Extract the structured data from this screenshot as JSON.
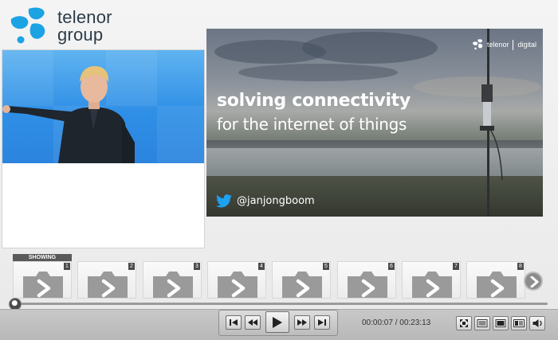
{
  "brand": {
    "logo_line1": "telenor",
    "logo_line2": "group",
    "logo_icon": "telenor-propeller-logo",
    "color": "#1ca3e3"
  },
  "slide": {
    "title_line1": "solving connectivity",
    "title_line2": "for the internet of things",
    "brand_name": "telenor",
    "brand_suffix": "digital",
    "twitter_handle": "@janjongboom",
    "twitter_icon": "twitter-bird-icon"
  },
  "thumbnails": {
    "showing_label": "SHOWING",
    "items": [
      {
        "num": "1",
        "icon": "play-placeholder-icon"
      },
      {
        "num": "2",
        "icon": "play-placeholder-icon"
      },
      {
        "num": "3",
        "icon": "play-placeholder-icon"
      },
      {
        "num": "4",
        "icon": "play-placeholder-icon"
      },
      {
        "num": "5",
        "icon": "play-placeholder-icon"
      },
      {
        "num": "6",
        "icon": "play-placeholder-icon"
      },
      {
        "num": "7",
        "icon": "play-placeholder-icon"
      },
      {
        "num": "8",
        "icon": "play-placeholder-icon"
      }
    ],
    "next_icon": "chevron-right-icon"
  },
  "playback": {
    "current_time": "00:00:07",
    "total_time": "00:23:13",
    "separator": " / ",
    "progress_fraction": 0.005
  },
  "controls": {
    "transport": [
      "skip-to-start-icon",
      "rewind-icon",
      "play-icon",
      "fast-forward-icon",
      "skip-to-end-icon"
    ],
    "view": [
      "fullscreen-icon",
      "layout-slides-icon",
      "layout-video-icon",
      "layout-both-icon",
      "volume-icon"
    ]
  }
}
